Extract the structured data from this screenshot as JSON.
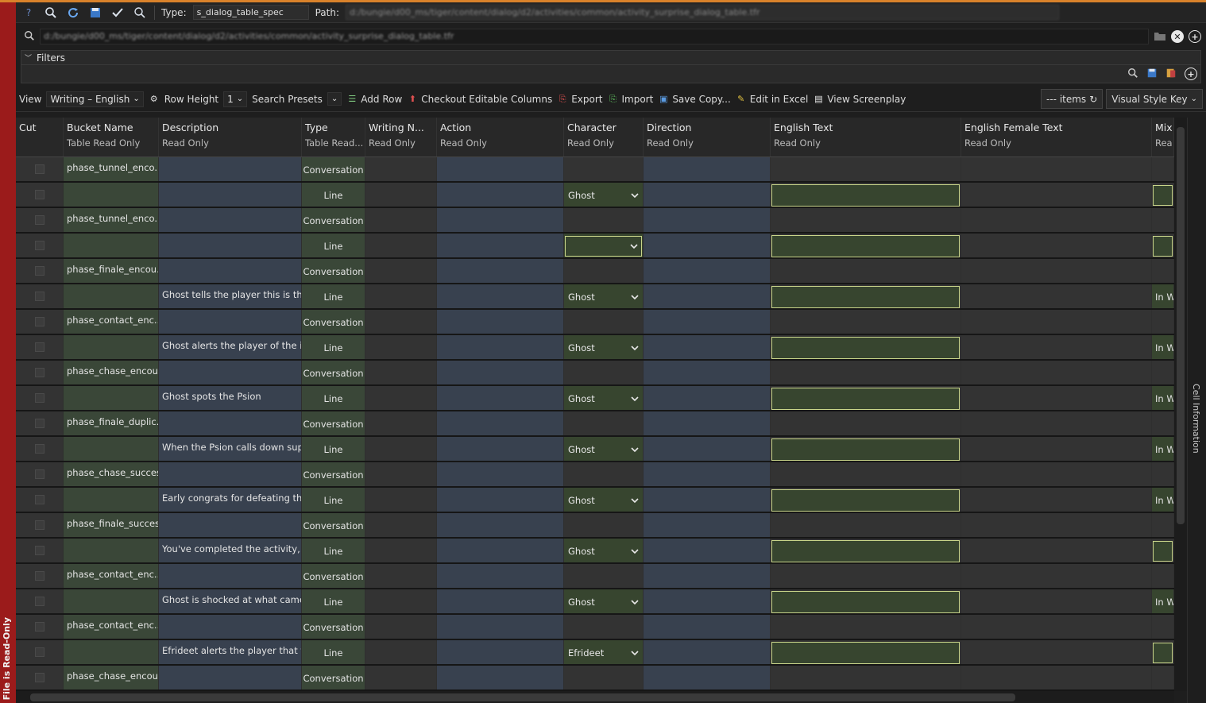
{
  "read_only_banner": "File is Read-Only",
  "toolbar": {
    "type_label": "Type:",
    "type_value": "s_dialog_table_spec",
    "path_label": "Path:",
    "path_value": "d:/bungie/d00_ms/tiger/content/dialog/d2/activities/common/activity_surprise_dialog_table.tfr"
  },
  "search": {
    "value": "d:/bungie/d00_ms/tiger/content/dialog/d2/activities/common/activity_surprise_dialog_table.tfr"
  },
  "filters": {
    "label": "Filters"
  },
  "toolbar2": {
    "view_label": "View",
    "view_value": "Writing – English",
    "row_height_label": "Row Height",
    "row_height_value": "1",
    "search_presets": "Search Presets",
    "add_row": "Add Row",
    "checkout": "Checkout Editable Columns",
    "export": "Export",
    "import": "Import",
    "save_copy": "Save Copy...",
    "edit_excel": "Edit in Excel",
    "view_screenplay": "View Screenplay",
    "items": "--- items",
    "visual_style": "Visual Style Key"
  },
  "side_panel": "Cell Information",
  "columns": [
    {
      "name": "Cut",
      "sub": ""
    },
    {
      "name": "Bucket Name",
      "sub": "Table Read Only"
    },
    {
      "name": "Description",
      "sub": "Read Only"
    },
    {
      "name": "Type",
      "sub": "Table Read..."
    },
    {
      "name": "Writing N...",
      "sub": "Read Only"
    },
    {
      "name": "Action",
      "sub": "Read Only"
    },
    {
      "name": "Character",
      "sub": "Read Only"
    },
    {
      "name": "Direction",
      "sub": "Read Only"
    },
    {
      "name": "English Text",
      "sub": "Read Only"
    },
    {
      "name": "English Female Text",
      "sub": "Read Only"
    },
    {
      "name": "Mix",
      "sub": "Rea"
    }
  ],
  "rows": [
    {
      "kind": "conv",
      "bucket": "phase_tunnel_enco...",
      "desc": "",
      "type": "Conversation"
    },
    {
      "kind": "line",
      "bucket": "",
      "desc": "",
      "type": "Line",
      "character": "Ghost",
      "mix": ""
    },
    {
      "kind": "conv",
      "bucket": "phase_tunnel_enco...",
      "desc": "",
      "type": "Conversation"
    },
    {
      "kind": "line",
      "bucket": "",
      "desc": "",
      "type": "Line",
      "character": "",
      "mix": "",
      "outlined": true
    },
    {
      "kind": "conv",
      "bucket": "phase_finale_encou...",
      "desc": "",
      "type": "Conversation"
    },
    {
      "kind": "line",
      "bucket": "",
      "desc": "Ghost tells the player this is the...",
      "type": "Line",
      "character": "Ghost",
      "mix": "In W"
    },
    {
      "kind": "conv",
      "bucket": "phase_contact_enc...",
      "desc": "",
      "type": "Conversation"
    },
    {
      "kind": "line",
      "bucket": "",
      "desc": "Ghost alerts the player of the in...",
      "type": "Line",
      "character": "Ghost",
      "mix": "In W"
    },
    {
      "kind": "conv",
      "bucket": "phase_chase_encou...",
      "desc": "",
      "type": "Conversation"
    },
    {
      "kind": "line",
      "bucket": "",
      "desc": "Ghost spots the Psion",
      "type": "Line",
      "character": "Ghost",
      "mix": "In W"
    },
    {
      "kind": "conv",
      "bucket": "phase_finale_duplic...",
      "desc": "",
      "type": "Conversation"
    },
    {
      "kind": "line",
      "bucket": "",
      "desc": "When the Psion calls down sup...",
      "type": "Line",
      "character": "Ghost",
      "mix": "In W"
    },
    {
      "kind": "conv",
      "bucket": "phase_chase_success",
      "desc": "",
      "type": "Conversation"
    },
    {
      "kind": "line",
      "bucket": "",
      "desc": "Early congrats for defeating th...",
      "type": "Line",
      "character": "Ghost",
      "mix": "In W"
    },
    {
      "kind": "conv",
      "bucket": "phase_finale_success",
      "desc": "",
      "type": "Conversation"
    },
    {
      "kind": "line",
      "bucket": "",
      "desc": "You've completed the activity,...",
      "type": "Line",
      "character": "Ghost",
      "mix": ""
    },
    {
      "kind": "conv",
      "bucket": "phase_contact_enc...",
      "desc": "",
      "type": "Conversation"
    },
    {
      "kind": "line",
      "bucket": "",
      "desc": "Ghost is shocked at what came...",
      "type": "Line",
      "character": "Ghost",
      "mix": "In W"
    },
    {
      "kind": "conv",
      "bucket": "phase_contact_enc...",
      "desc": "",
      "type": "Conversation"
    },
    {
      "kind": "line",
      "bucket": "",
      "desc": "Efrideet alerts the player that th...",
      "type": "Line",
      "character": "Efrideet",
      "mix": ""
    },
    {
      "kind": "conv",
      "bucket": "phase_chase_encou...",
      "desc": "",
      "type": "Conversation"
    }
  ],
  "colors": {
    "accent_orange": "#d9822b",
    "read_only_red": "#9b1b1b",
    "editable_outline": "#c9d58a",
    "bucket_bg": "#3a4738",
    "readonly_blue_bg": "#38414f"
  }
}
